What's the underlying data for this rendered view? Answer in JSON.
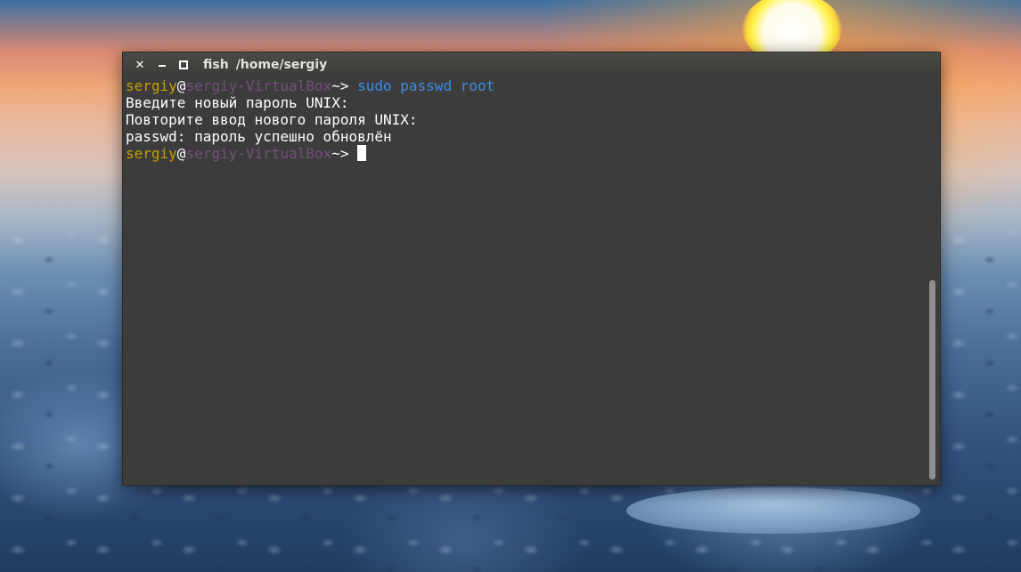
{
  "window": {
    "title_app": "fish",
    "title_path": "/home/sergiy",
    "buttons": {
      "close_icon": "close-icon",
      "minimize_icon": "minimize-icon",
      "maximize_icon": "maximize-icon"
    }
  },
  "terminal": {
    "prompt": {
      "user": "sergiy",
      "at": "@",
      "host": "sergiy-VirtualBox",
      "cwd": "~",
      "symbol": "> "
    },
    "command": "sudo passwd root",
    "output": [
      "Введите новый пароль UNIX:",
      "Повторите ввод нового пароля UNIX:",
      "passwd: пароль успешно обновлён"
    ]
  },
  "colors": {
    "user": "#c4a000",
    "host": "#75507b",
    "command": "#3b8eea",
    "background": "#3c3c3c"
  }
}
